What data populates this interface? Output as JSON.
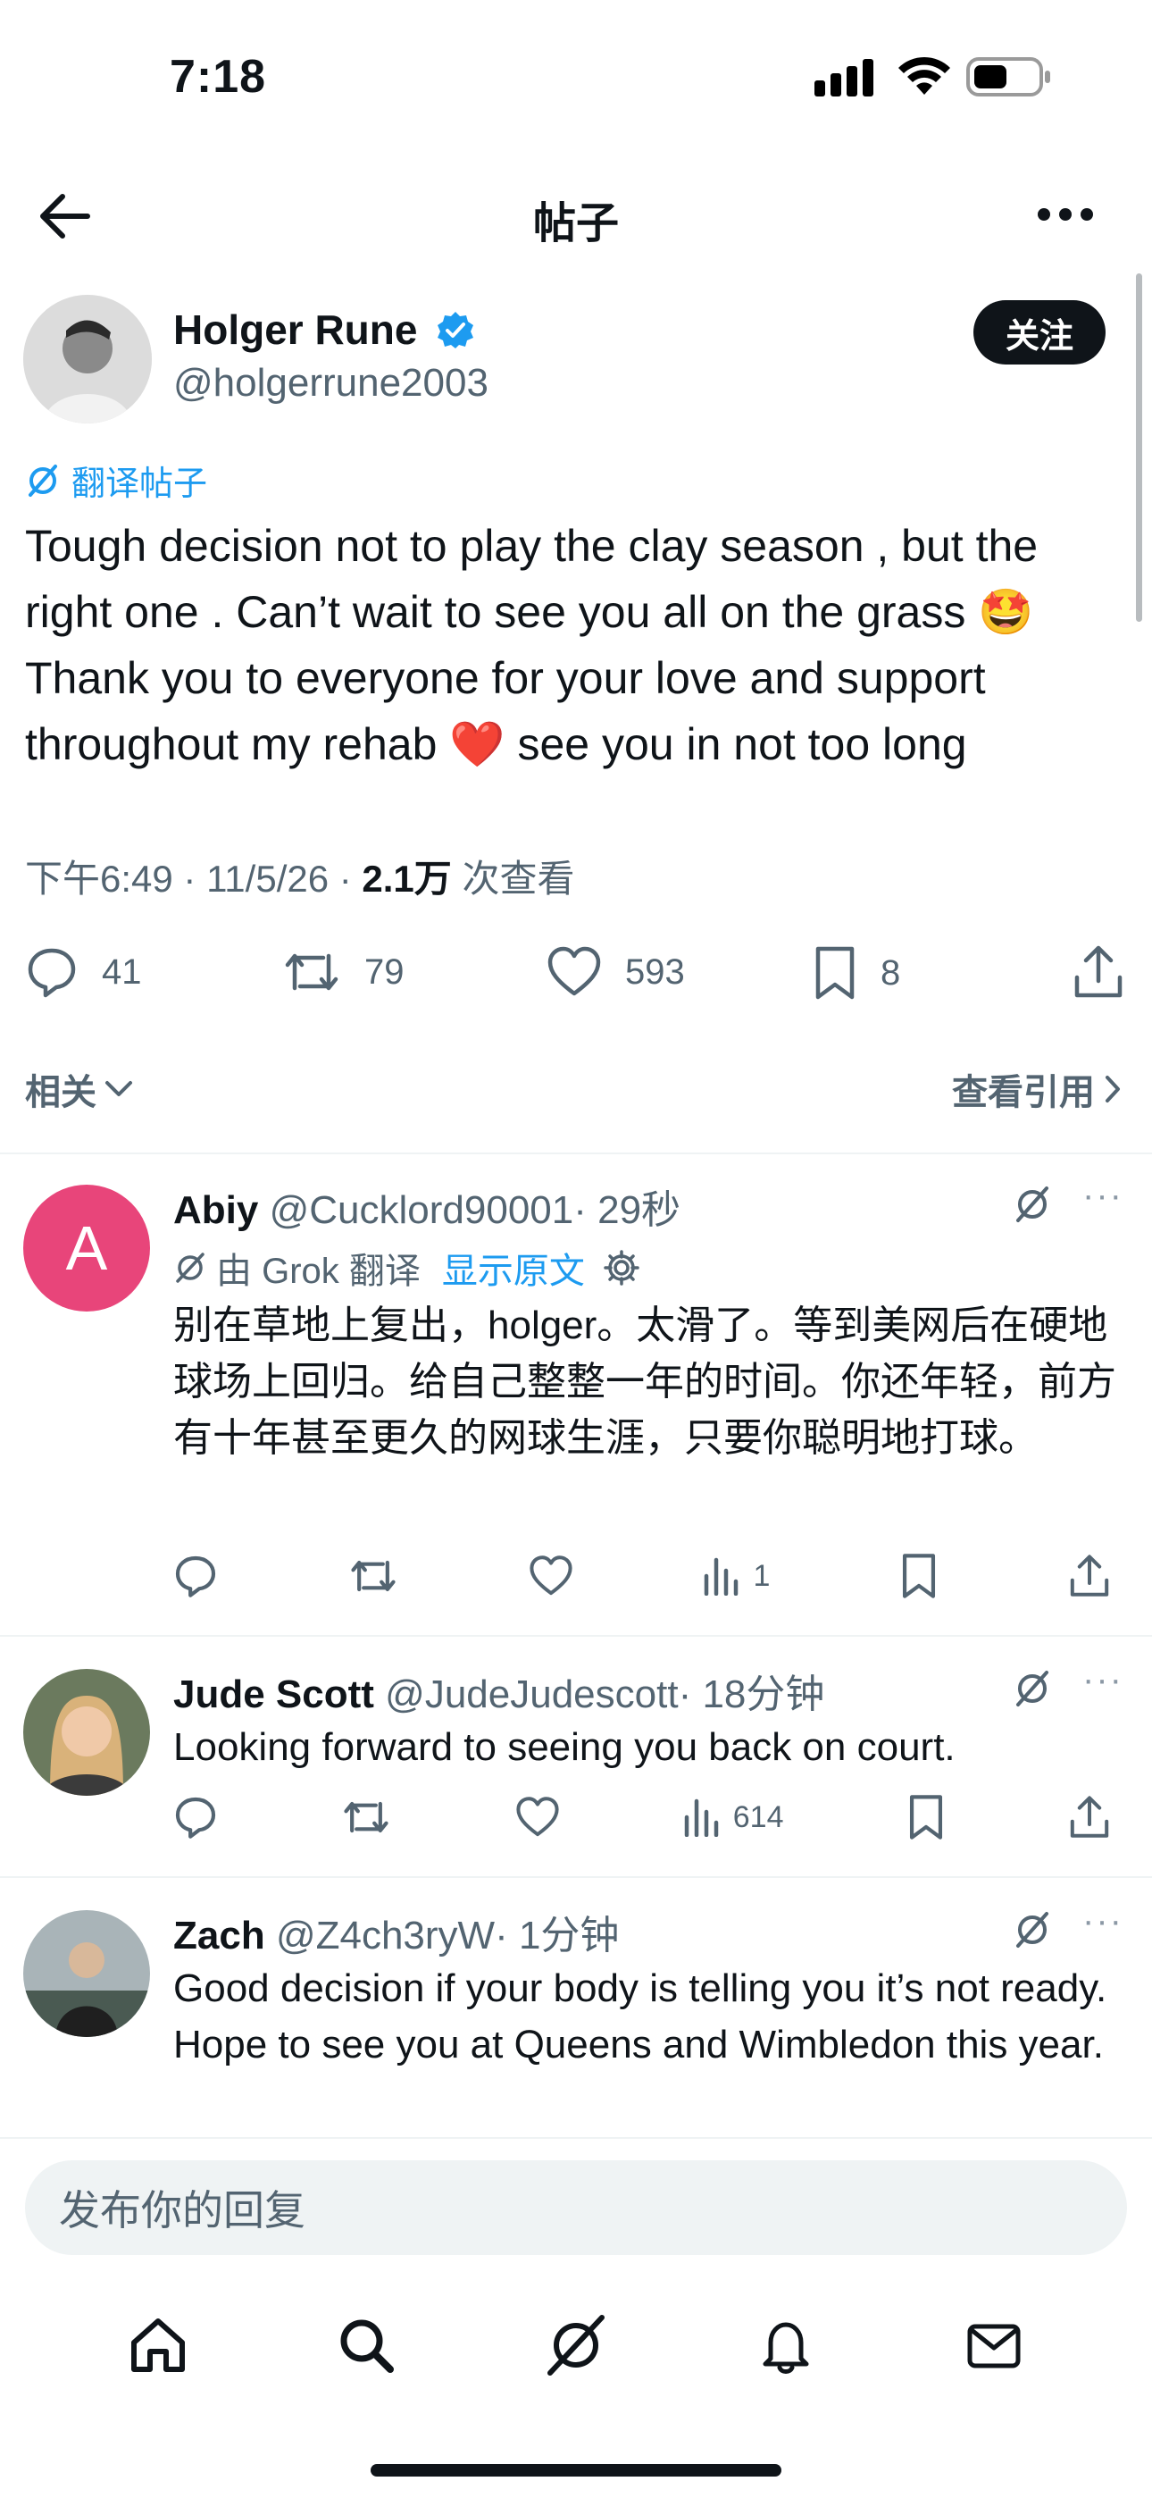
{
  "status_bar": {
    "time": "7:18"
  },
  "header": {
    "title": "帖子"
  },
  "post": {
    "author_name": "Holger Rune",
    "author_handle": "@holgerrune2003",
    "follow_label": "关注",
    "translate_label": "翻译帖子",
    "text": "Tough decision not to play the clay season , but the\nright one . Can’t wait to see you all on the grass 🤩\nThank you to everyone for your love and support\nthroughout my rehab ❤️ see you in not too long",
    "time": "下午6:49 · 11/5/26 · ",
    "views": "2.1万",
    "views_suffix": " 次查看",
    "replies": "41",
    "reposts": "79",
    "likes": "593",
    "bookmarks": "8"
  },
  "related": {
    "label": "相关",
    "quotes_label": "查看引用"
  },
  "replies": [
    {
      "avatar_letter": "A",
      "name": "Abiy",
      "handle": "@Cucklord90001",
      "time": "· 29秒",
      "grok_label": "由 Grok 翻译",
      "show_original": "显示原文",
      "text": "别在草地上复出，holger。太滑了。等到美网后在硬地球场上回归。给自己整整一年的时间。你还年轻，前方有十年甚至更久的网球生涯，只要你聪明地打球。",
      "views": "1"
    },
    {
      "name": "Jude Scott",
      "handle": "@JudeJudescott",
      "time": "· 18分钟",
      "text": "Looking forward to seeing you back on court.",
      "views": "614"
    },
    {
      "name": "Zach",
      "handle": "@Z4ch3ryW",
      "time": "· 1分钟",
      "text": "Good decision if your body is telling you it’s not ready. Hope to see you at Queens and Wimbledon this year."
    }
  ],
  "composer": {
    "placeholder": "发布你的回复"
  },
  "colors": {
    "accent": "#1d9bf0",
    "avatar_a": "#e8457a",
    "text": "#0f1419",
    "muted": "#536471"
  }
}
